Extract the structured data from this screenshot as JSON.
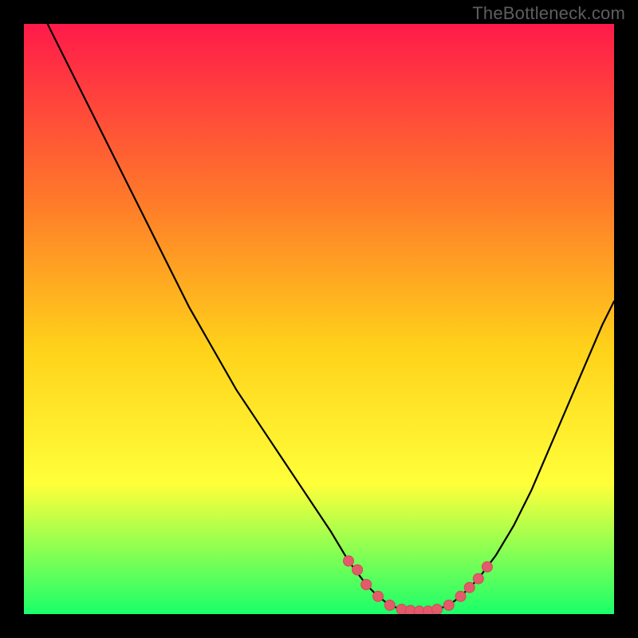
{
  "watermark": "TheBottleneck.com",
  "colors": {
    "frame": "#000000",
    "gradient_top": "#ff1a4a",
    "gradient_mid1": "#ff7a2a",
    "gradient_mid2": "#ffd21a",
    "gradient_mid3": "#ffff3a",
    "gradient_bottom": "#1aff6a",
    "curve": "#000000",
    "marker_fill": "#e35a6a",
    "marker_stroke": "#d04a5a"
  },
  "chart_data": {
    "type": "line",
    "title": "",
    "xlabel": "",
    "ylabel": "",
    "xlim": [
      0,
      100
    ],
    "ylim": [
      0,
      100
    ],
    "series": [
      {
        "name": "bottleneck-curve",
        "x": [
          4,
          8,
          12,
          16,
          20,
          24,
          28,
          32,
          36,
          40,
          44,
          48,
          52,
          55,
          58,
          60,
          62,
          64,
          66,
          68,
          70,
          72,
          74,
          77,
          80,
          83,
          86,
          89,
          92,
          95,
          98,
          100
        ],
        "y": [
          100,
          92,
          84,
          76,
          68,
          60,
          52,
          45,
          38,
          32,
          26,
          20,
          14,
          9,
          5,
          3,
          1.5,
          0.8,
          0.5,
          0.5,
          0.8,
          1.5,
          3,
          6,
          10,
          15,
          21,
          28,
          35,
          42,
          49,
          53
        ]
      }
    ],
    "markers": {
      "name": "highlight-points",
      "x": [
        55,
        56.5,
        58,
        60,
        62,
        64,
        65.5,
        67,
        68.5,
        70,
        72,
        74,
        75.5,
        77,
        78.5
      ],
      "y": [
        9,
        7.5,
        5,
        3,
        1.5,
        0.8,
        0.6,
        0.5,
        0.5,
        0.8,
        1.5,
        3,
        4.5,
        6,
        8
      ]
    }
  }
}
